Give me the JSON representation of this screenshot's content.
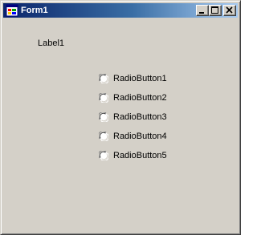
{
  "window": {
    "title": "Form1",
    "buttons": {
      "minimize_icon": "minimize-icon",
      "maximize_icon": "maximize-icon",
      "close_icon": "close-icon"
    },
    "title_gradient": [
      "#0a246a",
      "#a6caf0"
    ],
    "face_color": "#d4d0c8"
  },
  "form": {
    "label1": "Label1",
    "radio_buttons": [
      {
        "label": "RadioButton1",
        "checked": false
      },
      {
        "label": "RadioButton2",
        "checked": false
      },
      {
        "label": "RadioButton3",
        "checked": false
      },
      {
        "label": "RadioButton4",
        "checked": false
      },
      {
        "label": "RadioButton5",
        "checked": false
      }
    ]
  }
}
